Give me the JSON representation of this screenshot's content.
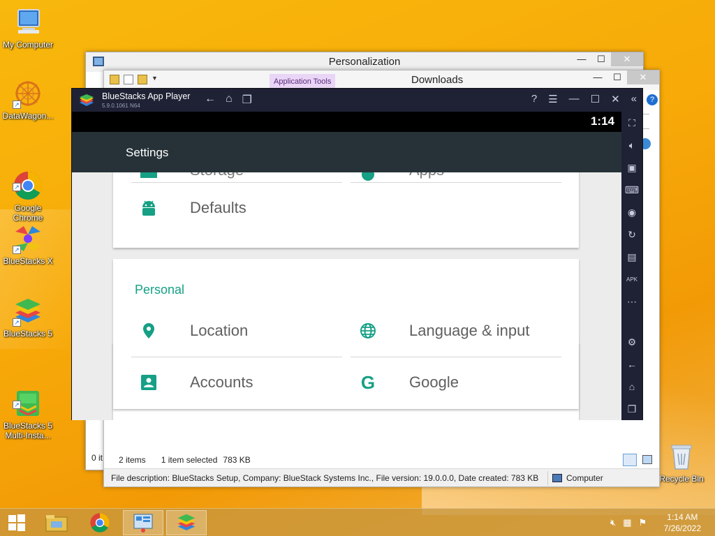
{
  "desktop": {
    "icons": [
      {
        "label": "My Computer"
      },
      {
        "label": "DataWagon..."
      },
      {
        "label": "Google\nChrome"
      },
      {
        "label": "BlueStacks X"
      },
      {
        "label": "BlueStacks 5"
      },
      {
        "label": "BlueStacks 5\nMulti-Insta..."
      },
      {
        "label": "Recycle Bin"
      }
    ]
  },
  "personalization_window": {
    "title": "Personalization",
    "status_items": "0 it"
  },
  "downloads_window": {
    "title": "Downloads",
    "ribbon_tab": "Application Tools",
    "status": {
      "items": "2 items",
      "selected": "1 item selected",
      "size": "783 KB"
    },
    "details": {
      "description": "File description: BlueStacks Setup, Company: BlueStack Systems Inc., File version: 19.0.0.0, Date created: 783 KB",
      "location": "Computer"
    }
  },
  "bluestacks": {
    "title": "BlueStacks App Player",
    "version": "5.9.0.1061 N64",
    "clock": "1:14",
    "app_title": "Settings",
    "top_items": [
      "Storage",
      "Apps"
    ],
    "device_items": [
      {
        "label": "Defaults",
        "icon": "android-icon"
      }
    ],
    "section_title": "Personal",
    "personal_items": [
      {
        "label": "Location",
        "icon": "location-pin-icon"
      },
      {
        "label": "Language & input",
        "icon": "globe-icon"
      },
      {
        "label": "Accounts",
        "icon": "account-icon"
      },
      {
        "label": "Google",
        "icon": "google-icon"
      }
    ],
    "accent": "#16a085",
    "sidebar_icons": [
      "fullscreen-icon",
      "volume-icon",
      "macro-icon",
      "keyboard-icon",
      "record-icon",
      "rotate-icon",
      "camera-icon",
      "apk-icon",
      "more-icon",
      "settings-icon",
      "back-icon",
      "home-icon",
      "recents-icon"
    ]
  },
  "taskbar": {
    "time": "1:14 AM",
    "date": "7/26/2022",
    "apps": [
      "start-icon",
      "file-explorer-icon",
      "chrome-icon",
      "control-panel-icon",
      "bluestacks-icon"
    ]
  }
}
